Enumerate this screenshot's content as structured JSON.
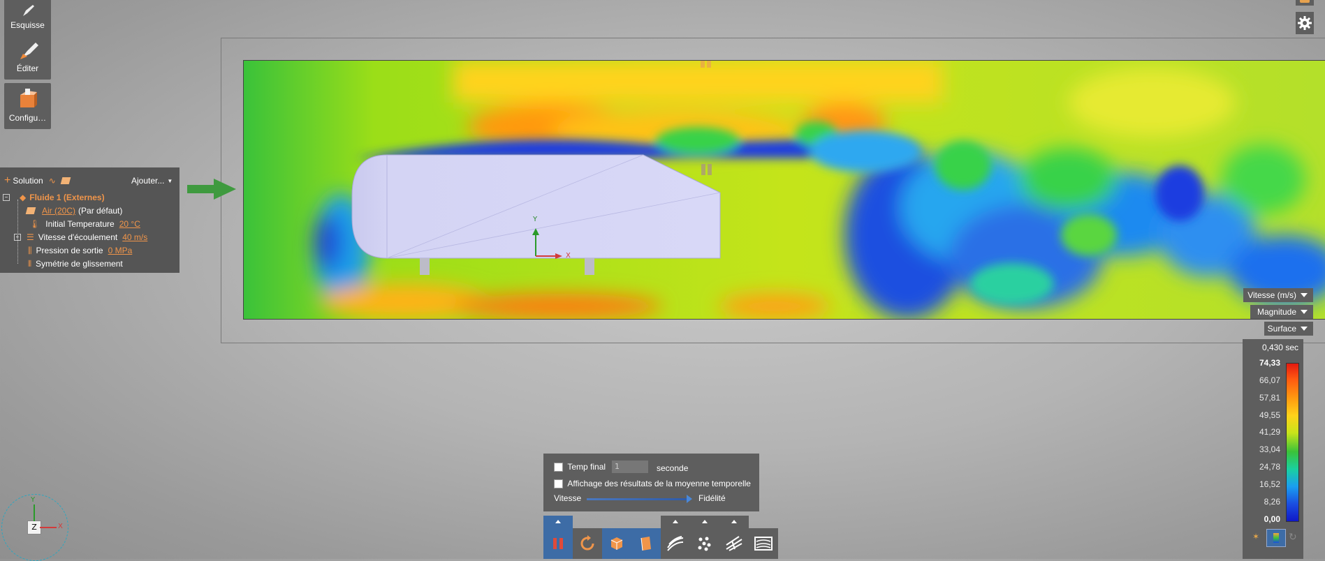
{
  "tools": {
    "sketch_label": "Esquisse",
    "edit_label": "Éditer",
    "config_label": "Configu…"
  },
  "tree": {
    "solution_label": "Solution",
    "add_label": "Ajouter...",
    "fluid_label": "Fluide 1 (Externes)",
    "material_value": "Air (20C)",
    "material_suffix": "(Par défaut)",
    "temp_label": "Initial Temperature",
    "temp_value": "20 °C",
    "velocity_label": "Vitesse d'écoulement",
    "velocity_value": "40 m/s",
    "pressure_label": "Pression de sortie",
    "pressure_value": "0 MPa",
    "symmetry_label": "Symétrie de glissement"
  },
  "axes_labels": {
    "y": "Y",
    "x": "X",
    "z": "Z"
  },
  "result": {
    "quantity": "Vitesse (m/s)",
    "component": "Magnitude",
    "display": "Surface",
    "time": "0,430 sec",
    "legend_values": [
      "74,33",
      "66,07",
      "57,81",
      "49,55",
      "41,29",
      "33,04",
      "24,78",
      "16,52",
      "8,26",
      "0,00"
    ]
  },
  "controls": {
    "final_time_label": "Temp final",
    "final_time_value": "1",
    "final_time_unit": "seconde",
    "time_avg_label": "Affichage des résultats de la moyenne temporelle",
    "slider_left": "Vitesse",
    "slider_right": "Fidélité"
  },
  "colors": {
    "accent_orange": "#f0954a",
    "panel": "#5e5e5e",
    "active_blue": "#3d6ca6"
  }
}
